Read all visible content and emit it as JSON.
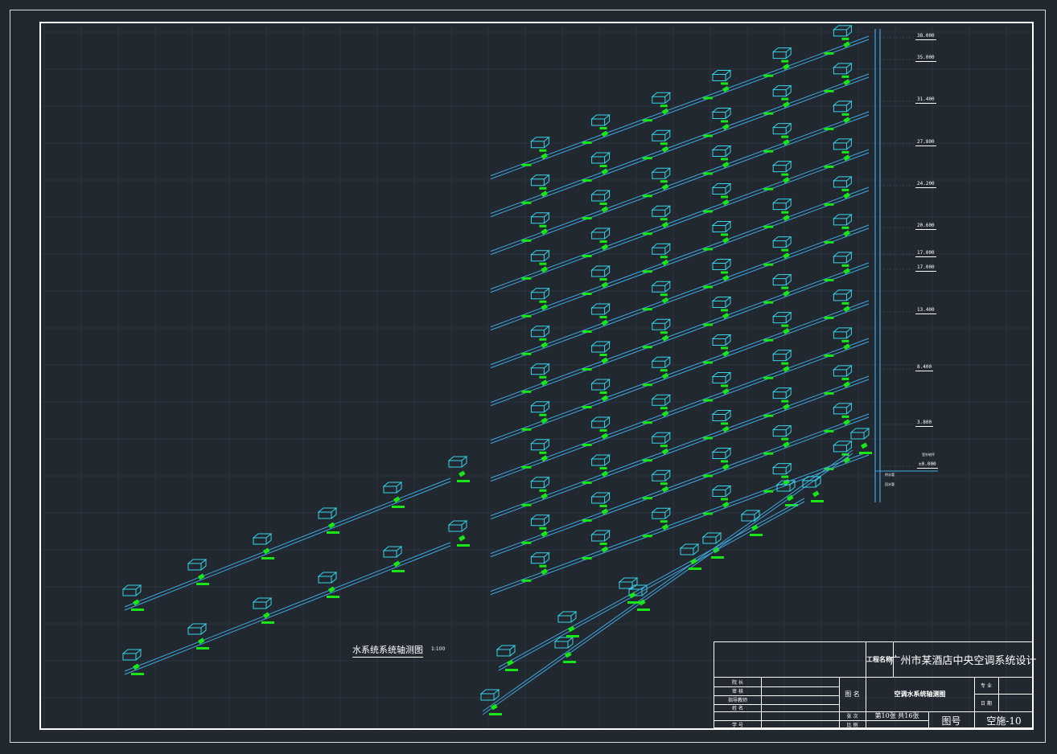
{
  "diagram": {
    "title": "水系统系统轴测图",
    "scale": "1:100"
  },
  "elevations": [
    "38.000",
    "35.000",
    "31.400",
    "27.800",
    "24.200",
    "20.600",
    "17.000",
    "17.000",
    "13.400",
    "8.400",
    "3.800",
    "±0.000"
  ],
  "riser_labels": [
    "供水管",
    "回水管"
  ],
  "ground_label": "室外地坪",
  "title_block": {
    "project_label": "工程名称",
    "project_name": "广州市某酒店中央空调系统设计",
    "drawing_label": "图  名",
    "drawing_name": "空调水系统轴测图",
    "specialty_label": "专  业",
    "date_label": "日  期",
    "rows": [
      "院  长",
      "审  核",
      "指导教师",
      "姓  名",
      "学  号"
    ],
    "sheet_label": "张  次",
    "sheet_value": "第10张  共16张",
    "scale_label": "比  例",
    "figure_no_label": "图号",
    "figure_no": "空施-10"
  },
  "colors": {
    "background": "#212830",
    "pipe": "#3fa8e0",
    "unit": "#38d4e8",
    "tag": "#19e619",
    "frame": "#ffffff"
  }
}
